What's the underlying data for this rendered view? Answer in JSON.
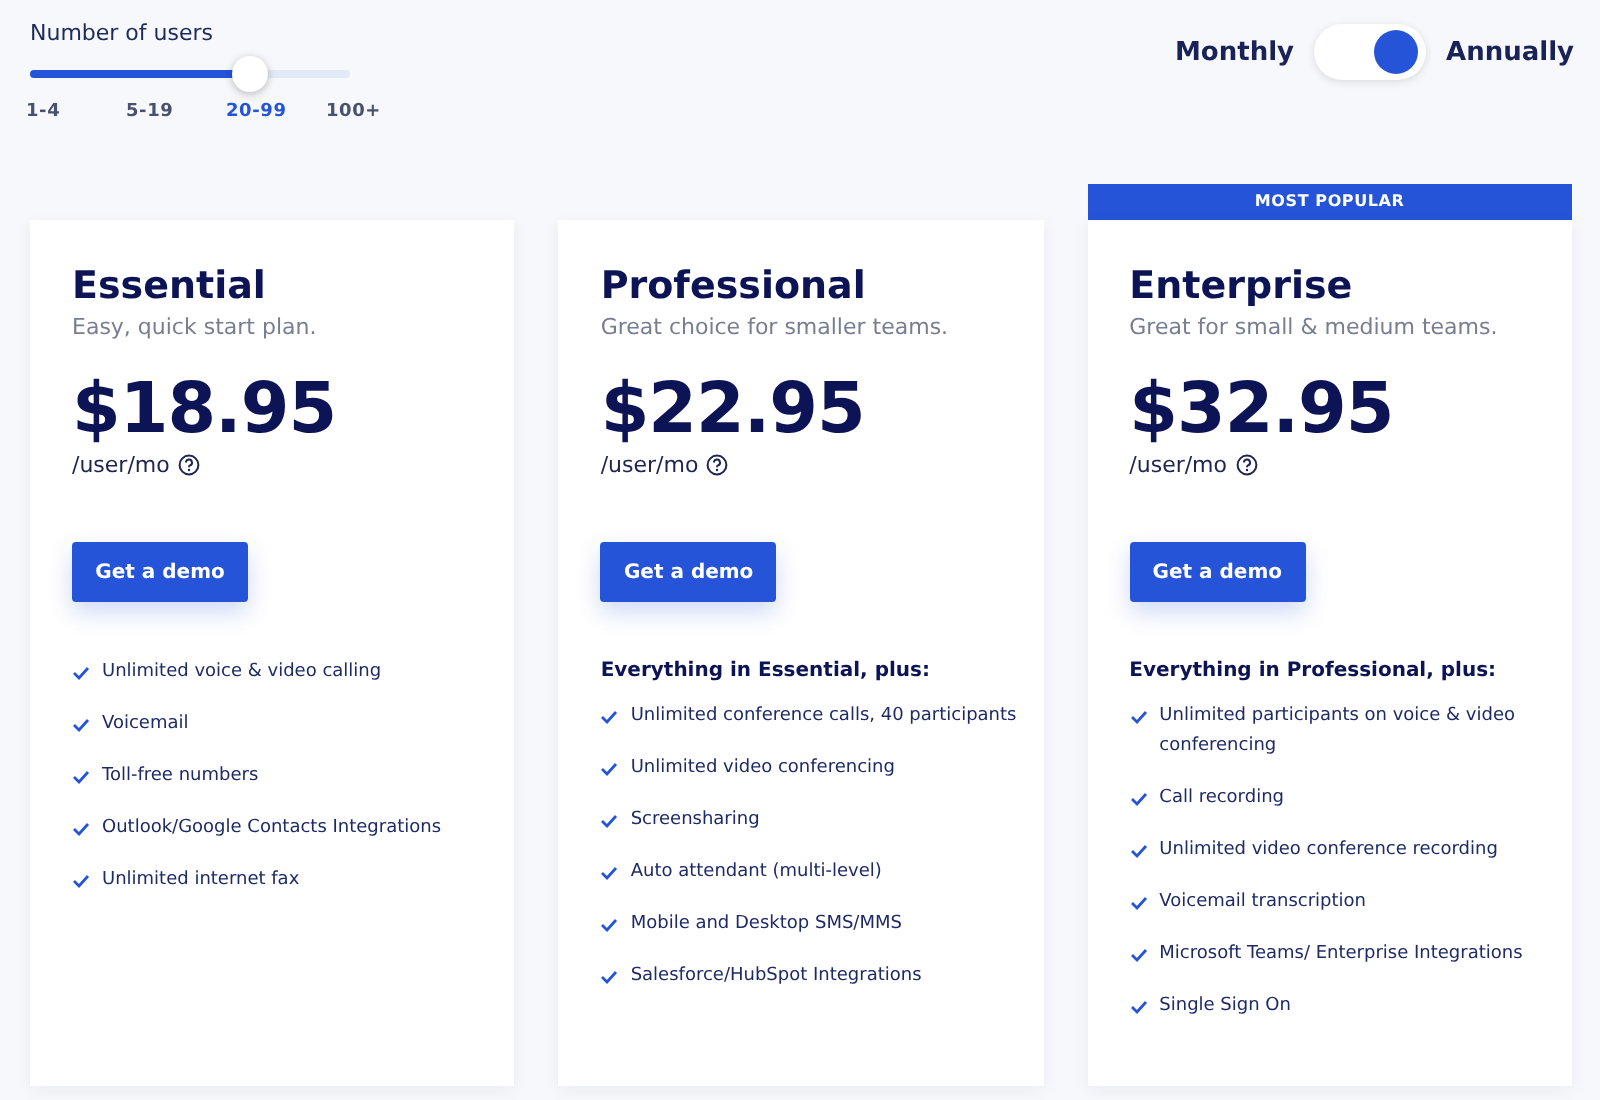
{
  "users": {
    "label": "Number of users",
    "level": 0.69,
    "ticks": [
      {
        "label": "1-4",
        "selected": false
      },
      {
        "label": "5-19",
        "selected": false
      },
      {
        "label": "20-99",
        "selected": true
      },
      {
        "label": "100+",
        "selected": false
      }
    ]
  },
  "billing_toggle": {
    "left_label": "Monthly",
    "right_label": "Annually",
    "on": true
  },
  "plans": [
    {
      "name": "Essential",
      "tagline": "Easy, quick start plan.",
      "price": "$18.95",
      "unit": "/user/mo",
      "button": "Get a demo",
      "features": [
        "Unlimited voice & video calling",
        "Voicemail",
        "Toll-free numbers",
        "Outlook/Google Contacts Integrations",
        "Unlimited internet fax"
      ]
    },
    {
      "name": "Professional",
      "tagline": "Great choice for smaller teams.",
      "price": "$22.95",
      "unit": "/user/mo",
      "button": "Get a demo",
      "intro": "Everything in Essential, plus:",
      "features": [
        "Unlimited conference calls, 40 participants",
        "Unlimited video conferencing",
        "Screensharing",
        "Auto attendant (multi-level)",
        "Mobile and Desktop SMS/MMS",
        "Salesforce/HubSpot Integrations"
      ]
    },
    {
      "name": "Enterprise",
      "tagline": "Great for small & medium teams.",
      "price": "$32.95",
      "unit": "/user/mo",
      "button": "Get a demo",
      "badge": "MOST POPULAR",
      "intro": "Everything in Professional, plus:",
      "features": [
        "Unlimited participants on voice & video conferencing",
        "Call recording",
        "Unlimited video conference recording",
        "Voicemail transcription",
        "Microsoft Teams/ Enterprise Integrations",
        "Single Sign On"
      ]
    }
  ]
}
